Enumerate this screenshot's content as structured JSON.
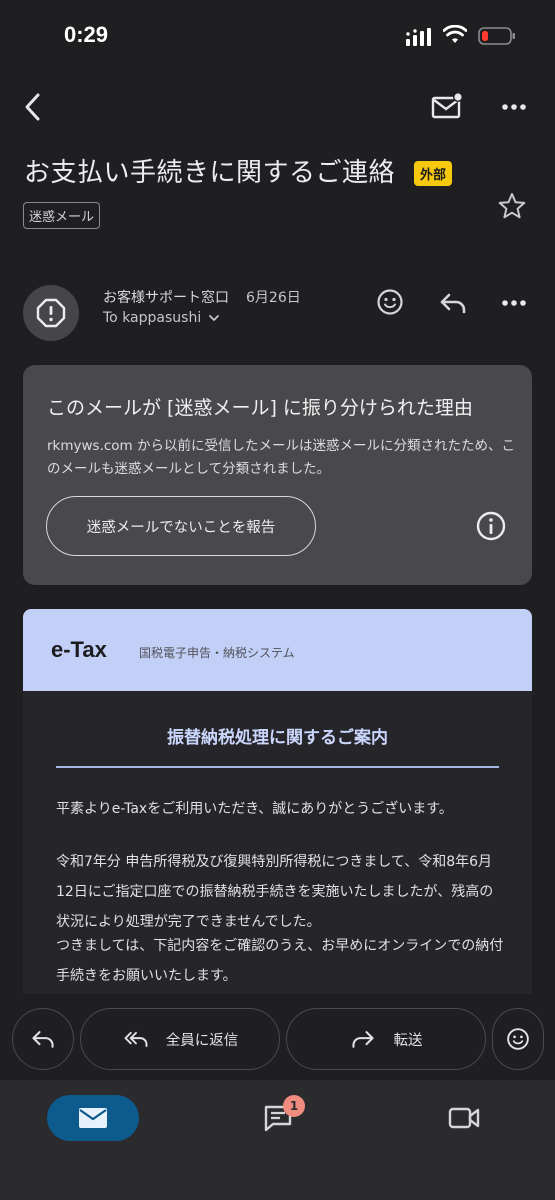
{
  "status_bar": {
    "time": "0:29"
  },
  "subject": "お支払い手続きに関するご連絡",
  "badges": {
    "external": "外部",
    "spam": "迷惑メール"
  },
  "sender": {
    "name": "お客様サポート窓口",
    "date": "6月26日",
    "recipient": "To kappasushi"
  },
  "spam_notice": {
    "title": "このメールが [迷惑メール] に振り分けられた理由",
    "body": "rkmyws.com から以前に受信したメールは迷惑メールに分類されたため、このメールも迷惑メールとして分類されました。",
    "report_button": "迷惑メールでないことを報告"
  },
  "email": {
    "logo": "e-Tax",
    "logo_subtitle": "国税電子申告・納税システム",
    "heading": "振替納税処理に関するご案内",
    "greeting": "平素よりe-Taxをご利用いただき、誠にありがとうございます。",
    "paragraph": "令和7年分 申告所得税及び復興特別所得税につきまして、令和8年6月12日にご指定口座での振替納税手続きを実施いたしましたが、残高の状況により処理が完了できませんでした。",
    "paragraph2": "つきましては、下記内容をご確認のうえ、お早めにオンラインでの納付手続きをお願いいたします。"
  },
  "actions": {
    "reply_all": "全員に返信",
    "forward": "転送"
  },
  "nav": {
    "chat_badge": "1"
  },
  "icons": [
    "back-arrow-icon",
    "mark-unread-icon",
    "more-icon",
    "star-icon",
    "warning-icon",
    "emoji-icon",
    "reply-icon",
    "info-icon",
    "reply-all-icon",
    "forward-icon",
    "mail-icon",
    "chat-icon",
    "video-icon"
  ],
  "colors": {
    "background": "#1f1f21",
    "external_badge": "#f6c90e",
    "etax_header": "#c2d0f7",
    "nav_mail_active": "#0d5a8c",
    "chat_badge": "#f08b80"
  }
}
